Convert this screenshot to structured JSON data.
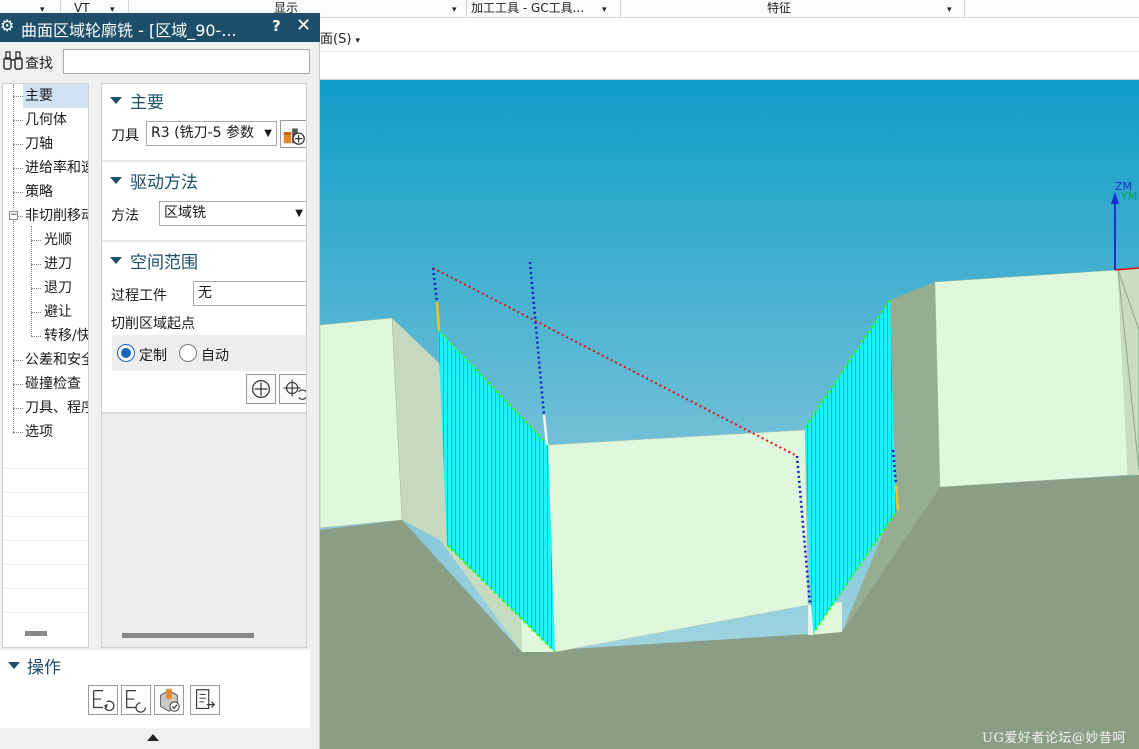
{
  "ribbon": {
    "item_vt": "VT",
    "item_display": "显示",
    "item_tool": "加工工具 - GC工具...",
    "item_feature": "特征",
    "menu_face": "面(S)",
    "caret": "▾"
  },
  "dialog": {
    "title": "曲面区域轮廓铣 - [区域_90-...",
    "help": "?",
    "close": "✕",
    "find_label": "查找",
    "find_value": ""
  },
  "nav_tree": {
    "items": [
      {
        "label": "主要"
      },
      {
        "label": "几何体"
      },
      {
        "label": "刀轴"
      },
      {
        "label": "进给率和速度"
      },
      {
        "label": "策略"
      },
      {
        "label": "非切削移动"
      },
      {
        "label": "光顺"
      },
      {
        "label": "进刀"
      },
      {
        "label": "退刀"
      },
      {
        "label": "避让"
      },
      {
        "label": "转移/快速"
      },
      {
        "label": "公差和安全"
      },
      {
        "label": "碰撞检查"
      },
      {
        "label": "刀具、程序"
      },
      {
        "label": "选项"
      }
    ],
    "toggle_symbol": "−"
  },
  "main_section": {
    "title": "主要",
    "tool_label": "刀具",
    "tool_value": "R3 (铣刀-5 参数"
  },
  "drive_section": {
    "title": "驱动方法",
    "method_label": "方法",
    "method_value": "区域铣"
  },
  "space_section": {
    "title": "空间范围",
    "workpiece_label": "过程工件",
    "workpiece_value": "无",
    "start_label": "切削区域起点",
    "radio_custom": "定制",
    "radio_auto": "自动"
  },
  "operation_section": {
    "title": "操作"
  },
  "viewport": {
    "axis_zm": "ZM",
    "axis_ym": "YM",
    "watermark": "UG爱好者论坛@妙昔呵"
  },
  "colors": {
    "title_bar": "#1d4f6b",
    "sky_top": "#0e9ec7",
    "sky_bottom": "#9fd3e3",
    "part_face": "#dff8dd",
    "floor": "#8a9e86",
    "toolpath": "#14f6ff",
    "rapid": "#e01010",
    "engage": "#1020c0"
  }
}
